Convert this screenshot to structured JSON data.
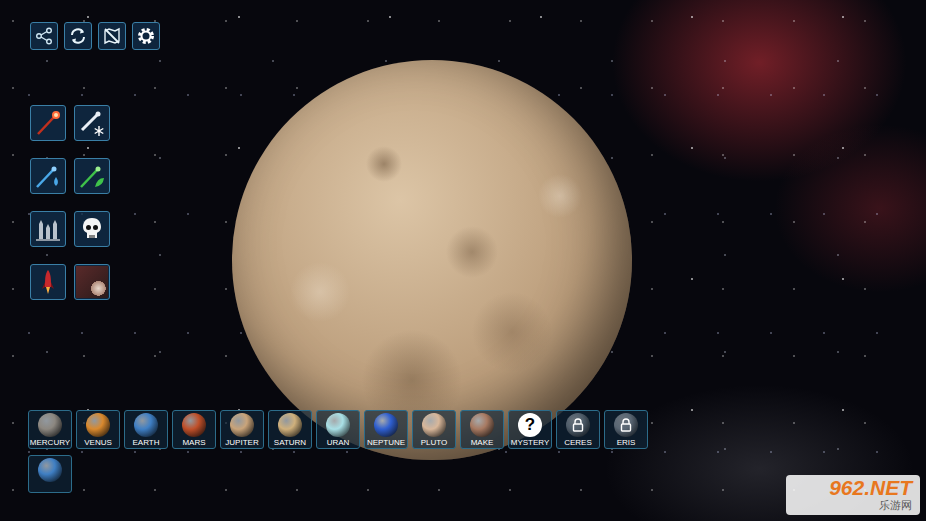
{
  "planet_rows": [
    [
      {
        "kind": "planet",
        "label": "MERCURY",
        "color": "#8c8780",
        "locked": false
      },
      {
        "kind": "planet",
        "label": "VENUS",
        "color": "#d9892e",
        "locked": false
      },
      {
        "kind": "planet",
        "label": "EARTH",
        "color": "#3f7fc4",
        "locked": false
      },
      {
        "kind": "planet",
        "label": "MARS",
        "color": "#c0502a",
        "locked": false
      },
      {
        "kind": "planet",
        "label": "JUPITER",
        "color": "#c9a47a",
        "locked": false
      },
      {
        "kind": "planet",
        "label": "SATURN",
        "color": "#cfb07c",
        "locked": false
      },
      {
        "kind": "planet",
        "label": "URAN",
        "color": "#a9e0e6",
        "locked": false
      },
      {
        "kind": "planet",
        "label": "NEPTUNE",
        "color": "#2f5fd0",
        "locked": false
      },
      {
        "kind": "planet",
        "label": "PLUTO",
        "color": "#d8b79a",
        "locked": false
      },
      {
        "kind": "planet",
        "label": "MAKE",
        "color": "#a87a62",
        "locked": false
      },
      {
        "kind": "mystery",
        "label": "MYSTERY",
        "icon": "?",
        "color": "#ffffff",
        "locked": false
      },
      {
        "kind": "planet",
        "label": "CERES",
        "color": "#6d7a86",
        "locked": true
      },
      {
        "kind": "planet",
        "label": "ERIS",
        "color": "#7c8894",
        "locked": true
      }
    ],
    [
      {
        "kind": "planet",
        "color": "#3f7fc4",
        "locked": false
      }
    ]
  ],
  "watermark": {
    "brand": "962.NET",
    "sub": "乐游网"
  }
}
